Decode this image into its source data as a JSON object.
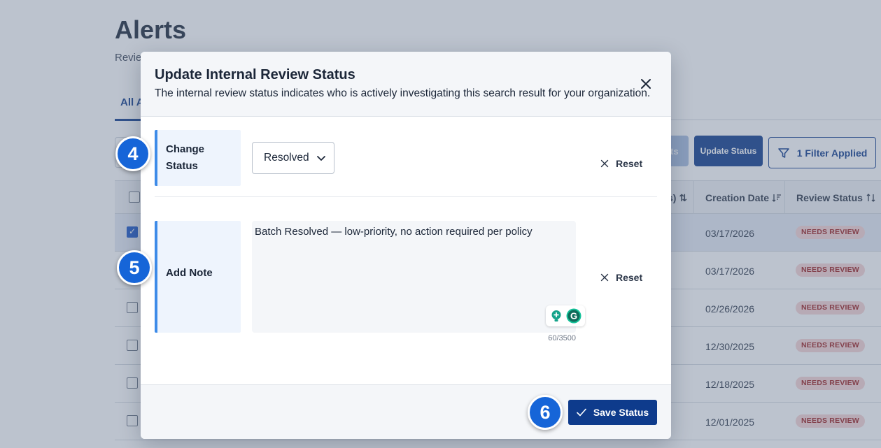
{
  "page": {
    "title": "Alerts",
    "subtitle": "Revie",
    "tab_active": "All A",
    "toolbar": {
      "disabled_button": "ts",
      "update_status": "Update Status",
      "filter": "1 Filter Applied"
    },
    "table": {
      "columns": [
        {
          "label": "s) ⇅"
        },
        {
          "label": "Creation Date"
        },
        {
          "label": "Review Status"
        }
      ],
      "rows": [
        {
          "date": "03/17/2026",
          "status": "NEEDS REVIEW",
          "checked": true
        },
        {
          "date": "03/17/2026",
          "status": "NEEDS REVIEW",
          "checked": false
        },
        {
          "date": "02/26/2026",
          "status": "NEEDS REVIEW",
          "checked": false
        },
        {
          "date": "12/30/2025",
          "status": "NEEDS REVIEW",
          "checked": false
        },
        {
          "date": "12/18/2025",
          "status": "NEEDS REVIEW",
          "checked": false
        },
        {
          "date": "12/01/2025",
          "status": "NEEDS REVIEW",
          "checked": false
        }
      ]
    }
  },
  "modal": {
    "title": "Update Internal Review Status",
    "description": "The internal review status indicates who is actively investigating this search result for your organization.",
    "change_status": {
      "label_line1": "Change",
      "label_line2": "Status",
      "selected_value": "Resolved",
      "reset": "Reset"
    },
    "add_note": {
      "label": "Add Note",
      "value": "Batch Resolved — low-priority, no action required per policy",
      "counter": "60/3500",
      "reset": "Reset"
    },
    "save_button": "Save Status"
  },
  "steps": {
    "step4": "4",
    "step5": "5",
    "step6": "6"
  },
  "colors": {
    "primary": "#0e3b8c",
    "accent_blue": "#3d8be8",
    "step_blue": "#1665d8",
    "badge_bg": "#f6d5d5",
    "badge_text": "#9b1c1c"
  }
}
